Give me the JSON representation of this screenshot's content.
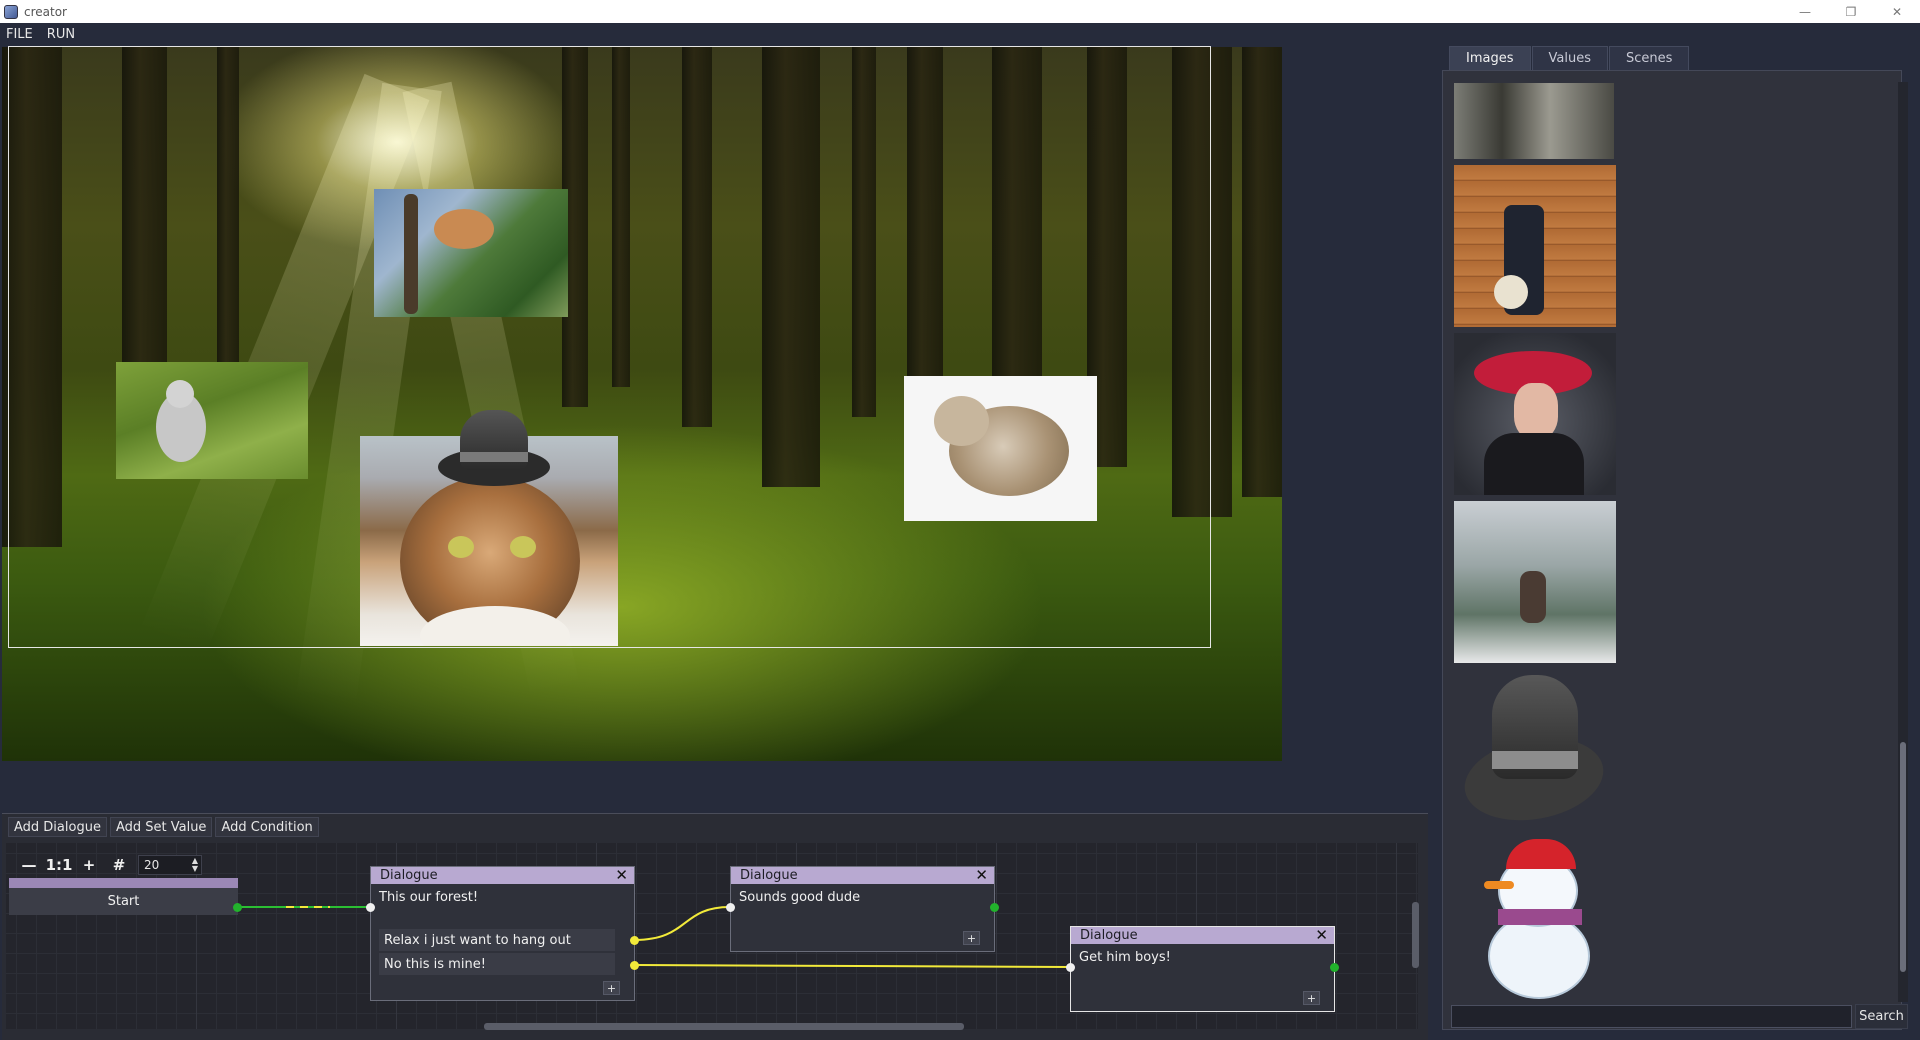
{
  "window": {
    "title": "creator",
    "minimize": "—",
    "restore": "❐",
    "close": "✕"
  },
  "menu": {
    "file": "FILE",
    "run": "RUN"
  },
  "assets": {
    "tabs": [
      "Images",
      "Values",
      "Scenes"
    ],
    "active_tab": "Images",
    "search_value": "",
    "search_button": "Search"
  },
  "node_editor": {
    "toolbar": [
      "Add Dialogue",
      "Add Set Value",
      "Add Condition"
    ],
    "zoom": {
      "minus": "—",
      "reset": "1:1",
      "plus": "+",
      "grid": "#",
      "value": "20"
    },
    "start_label": "Start",
    "nodes": [
      {
        "title": "Dialogue",
        "text": "This our forest!",
        "choices": [
          "Relax i just want to hang out",
          "No this is mine!"
        ],
        "add": "+"
      },
      {
        "title": "Dialogue",
        "text": "Sounds good dude",
        "choices": [],
        "add": "+"
      },
      {
        "title": "Dialogue",
        "text": "Get him boys!",
        "choices": [],
        "add": "+"
      }
    ],
    "close_glyph": "✕"
  },
  "colors": {
    "accent_node": "#b8a9d1",
    "wire_yellow": "#f2ea3a",
    "port_green": "#22b22c"
  }
}
